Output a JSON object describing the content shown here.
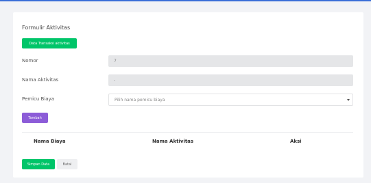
{
  "form": {
    "title": "Formulir Aktivitas",
    "data_button_label": "Data Transaksi aktivitas",
    "nomor": {
      "label": "Nomor",
      "value": "7"
    },
    "nama_aktivitas": {
      "label": "Nama Aktivitas",
      "value": "-"
    },
    "pemicu_biaya": {
      "label": "Pemicu Biaya",
      "placeholder": "Pilih nama pemicu biaya"
    },
    "add_button_label": "Tambah"
  },
  "table": {
    "headers": [
      "Nama Biaya",
      "Nama Aktivitas",
      "Aksi"
    ]
  },
  "footer": {
    "save_label": "Simpan Data",
    "cancel_label": "Batal"
  },
  "colors": {
    "accent_green": "#00c569",
    "accent_purple": "#8c5cd8",
    "top_line": "#3b6fd8"
  }
}
